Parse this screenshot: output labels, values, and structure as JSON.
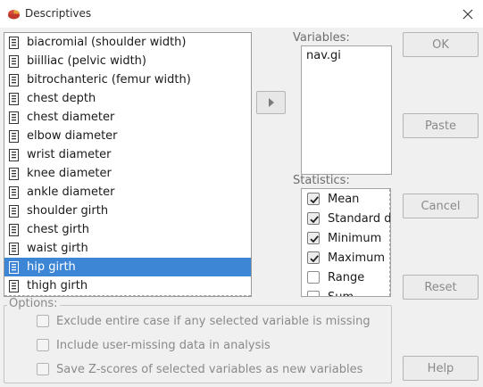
{
  "window": {
    "title": "Descriptives"
  },
  "source_variables": [
    "biacromial (shoulder width)",
    "biilliac (pelvic width)",
    "bitrochanteric (femur width)",
    "chest depth",
    "chest diameter",
    "elbow diameter",
    "wrist diameter",
    "knee diameter",
    "ankle diameter",
    "shoulder girth",
    "chest girth",
    "waist girth",
    "hip girth",
    "thigh girth"
  ],
  "selected_source_variable": "hip girth",
  "variables": {
    "label": "Variables:",
    "items": [
      "nav.gi"
    ]
  },
  "statistics": {
    "label": "Statistics:",
    "items": [
      {
        "label": "Mean",
        "checked": true
      },
      {
        "label": "Standard d",
        "checked": true
      },
      {
        "label": "Minimum",
        "checked": true
      },
      {
        "label": "Maximum",
        "checked": true
      },
      {
        "label": "Range",
        "checked": false
      },
      {
        "label": "Sum",
        "checked": false
      }
    ]
  },
  "buttons": {
    "ok": "OK",
    "paste": "Paste",
    "cancel": "Cancel",
    "reset": "Reset",
    "help": "Help"
  },
  "options": {
    "label": "Options:",
    "items": [
      {
        "label": "Exclude entire case if any selected variable is missing",
        "checked": false
      },
      {
        "label": "Include user-missing data in analysis",
        "checked": false
      },
      {
        "label": "Save Z-scores of selected variables as new variables",
        "checked": false
      }
    ]
  },
  "colors": {
    "selection": "#3d86d6",
    "disabled_text": "#8a8a8a",
    "background": "#f0f0f0"
  },
  "icons": {
    "app": "pie-chart-icon",
    "variable": "scale-variable-icon",
    "move": "arrow-right-icon",
    "close": "close-icon"
  }
}
